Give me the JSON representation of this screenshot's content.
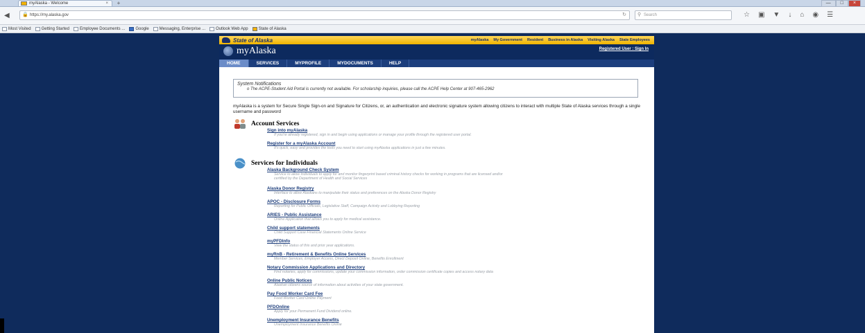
{
  "browser": {
    "tab_title": "myAlaska - Welcome",
    "tab_close": "×",
    "new_tab": "+",
    "window_controls": [
      "—",
      "□",
      "×"
    ],
    "url": "https://my.alaska.gov",
    "search_placeholder": "Search",
    "bookmarks": [
      {
        "label": "Most Visited",
        "icon": "folder-icon"
      },
      {
        "label": "Getting Started",
        "icon": "page-icon"
      },
      {
        "label": "Employee Documents ...",
        "icon": "page-icon"
      },
      {
        "label": "Google",
        "icon": "google-icon"
      },
      {
        "label": "Messaging, Enterprise ...",
        "icon": "page-icon"
      },
      {
        "label": "Outlook Web App",
        "icon": "page-icon"
      },
      {
        "label": "State of Alaska",
        "icon": "alaska-icon"
      }
    ]
  },
  "site": {
    "state_logo_text": "State of Alaska",
    "top_links": [
      "myAlaska",
      "My Government",
      "Resident",
      "Business in Alaska",
      "Visiting Alaska",
      "State Employees"
    ],
    "title": "myAlaska",
    "signin": "Registered User : Sign In",
    "nav": [
      "HOME",
      "SERVICES",
      "MYPROFILE",
      "MYDOCUMENTS",
      "HELP"
    ],
    "nav_active": "HOME",
    "notification": {
      "title": "System Notifications",
      "message": "o  The ACPE-Student Aid Portal is currently not available. For scholarship inquiries, please call the ACPE Help Center at 907-465-2962"
    },
    "intro": "myAlaska is a system for Secure Single Sign-on and Signature for Citizens, or, an authentication and electronic signature system allowing citizens to interact with multiple State of Alaska services through a single username and password",
    "account_services": {
      "title": "Account Services",
      "items": [
        {
          "link": "Sign into myAlaska",
          "desc": "If you're already registered, sign in and begin using applications or manage your profile through the registered user portal."
        },
        {
          "link": "Register for a myAlaska Account",
          "desc": "It's quick, easy and provides the tools you need to start using myAlaska applications in just a few minutes."
        }
      ]
    },
    "individual_services": {
      "title": "Services for Individuals",
      "items": [
        {
          "link": "Alaska Background Check System",
          "desc": "Service to allow individuals to apply for and monitor fingerprint based criminal history checks for working in programs that are licensed and/or",
          "desc2": "certified by the Department of Health and Social Services"
        },
        {
          "link": "Alaska Donor Registry",
          "desc": "Interface to allow Alaskans to manipulate their status and preferences on the Alaska Donor Registry"
        },
        {
          "link": "APOC - Disclosure Forms",
          "desc": "Reporting for Public Officials, Legislative Staff, Campaign Activity and Lobbying Reporting"
        },
        {
          "link": "ARIES - Public Assistance",
          "desc": "Online Application that allows you to apply for medical assistance."
        },
        {
          "link": "Child support statements",
          "desc": "Child Support Case Financial Statements Online Service"
        },
        {
          "link": "myPFDInfo",
          "desc": "View the status of this and prior year applications."
        },
        {
          "link": "myRnB - Retirement & Benefits Online Services",
          "desc": "Member Services, Employer Access, Direct Deposit Online, Benefits Enrollment"
        },
        {
          "link": "Notary Commission Applications and Directory",
          "desc": "Find notaries, apply for commissions, update your commission information, order commission certificate copies and access notary data"
        },
        {
          "link": "Online Public Notices",
          "desc": "Alaskan citizens source of information about activities of your state government."
        },
        {
          "link": "Pay Food Worker Card Fee",
          "desc": "Food Worker Card Online Payment"
        },
        {
          "link": "PFDOnline",
          "desc": "Apply for your Permanent Fund Dividend online."
        },
        {
          "link": "Unemployment Insurance Benefits",
          "desc": "Unemployment Insurance Benefits Online"
        }
      ]
    }
  }
}
